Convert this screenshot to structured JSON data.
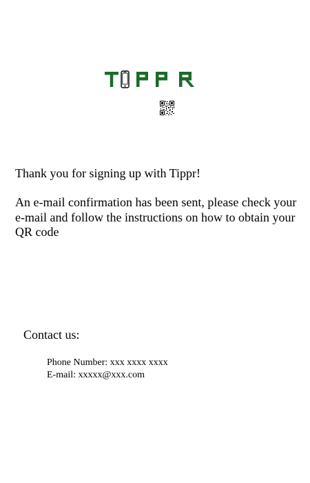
{
  "brand": {
    "name": "TIPPR",
    "color": "#1a6b2a"
  },
  "message": {
    "thanks": "Thank you for signing up with Tippr!",
    "confirmation": "An e-mail confirmation has been sent, please check your e-mail and follow the instructions on how to obtain your QR code"
  },
  "contact": {
    "heading": "Contact us:",
    "phone": "Phone Number: xxx xxxx xxxx",
    "email": "E-mail: xxxxx@xxx.com"
  },
  "icons": {
    "logo_phone": "smartphone-icon",
    "qr": "qr-code-icon"
  }
}
